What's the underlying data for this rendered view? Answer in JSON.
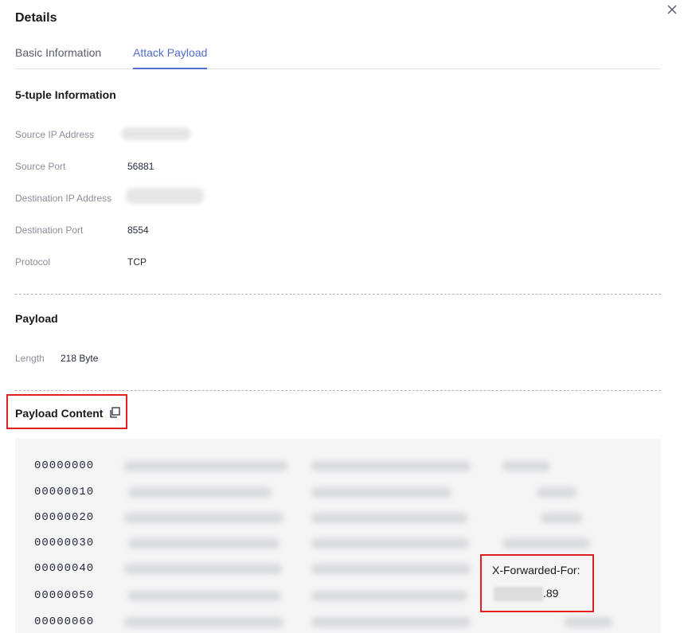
{
  "dialog": {
    "title": "Details"
  },
  "tabs": [
    {
      "label": "Basic Information",
      "active": false
    },
    {
      "label": "Attack Payload",
      "active": true
    }
  ],
  "five_tuple": {
    "title": "5-tuple Information",
    "fields": [
      {
        "label": "Source IP Address",
        "value": "",
        "redacted": true
      },
      {
        "label": "Source Port",
        "value": "56881"
      },
      {
        "label": "Destination IP Address",
        "value": "",
        "redacted": true
      },
      {
        "label": "Destination Port",
        "value": "8554"
      },
      {
        "label": "Protocol",
        "value": "TCP"
      }
    ]
  },
  "payload": {
    "title": "Payload",
    "length_label": "Length",
    "length_value": "218 Byte"
  },
  "payload_content": {
    "title": "Payload Content",
    "copy_icon": "copy-icon",
    "offsets": [
      "00000000",
      "00000010",
      "00000020",
      "00000030",
      "00000040",
      "00000050",
      "00000060"
    ],
    "callout": {
      "header": "X-Forwarded-For:",
      "ip_suffix": ".89"
    }
  },
  "colors": {
    "accent": "#526ecc",
    "highlight_border": "#e02020",
    "panel_bg": "#f5f5f6"
  }
}
